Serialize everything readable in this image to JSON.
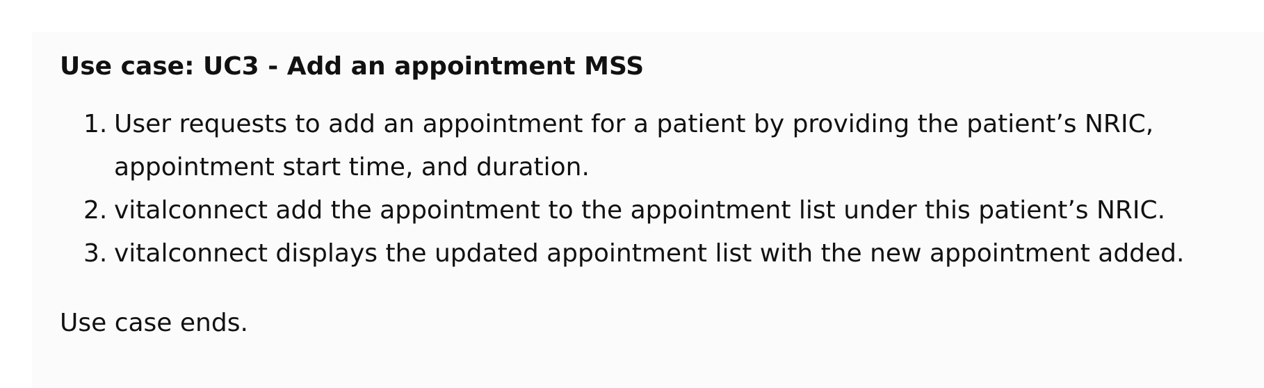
{
  "doc": {
    "title": "Use case: UC3 - Add an appointment MSS",
    "steps": [
      "User requests to add an appointment for a patient by providing the patient’s NRIC, appointment start time, and duration.",
      "vitalconnect add the appointment to the appointment list under this patient’s NRIC.",
      "vitalconnect displays the updated appointment list with the new appointment added."
    ],
    "ending": "Use case ends."
  }
}
